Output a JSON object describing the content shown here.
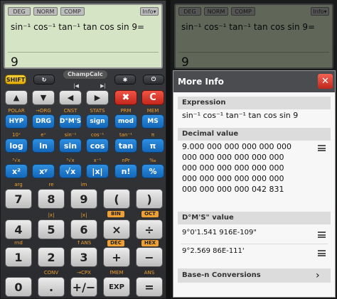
{
  "modes": [
    "DEG",
    "NORM",
    "COMP"
  ],
  "info": "Info",
  "expression": "sin⁻¹ cos⁻¹ tan⁻¹ tan cos sin 9=",
  "result": "9",
  "brand": "ChampCalc",
  "row0": [
    "SHIFT",
    "↻",
    "✱",
    "⏻"
  ],
  "row1": [
    "▲",
    "▼",
    "◀",
    "▶",
    "✖",
    "C"
  ],
  "row1top": [
    "|◀",
    "▶|"
  ],
  "row2lbl": [
    "POLAR",
    "→DRG",
    "CNST",
    "STATS",
    "PRM",
    "MEM"
  ],
  "row2": [
    "HYP",
    "DRG",
    "D°M'S",
    "sign",
    "mod",
    "MS"
  ],
  "row3lbl": [
    "10ˣ",
    "eˣ",
    "sin⁻¹",
    "cos⁻¹",
    "tan⁻¹",
    "π"
  ],
  "row3": [
    "log",
    "ln",
    "sin",
    "cos",
    "tan",
    "π"
  ],
  "row4lbl": [
    "³√x",
    "",
    "³√x",
    "x⁻¹",
    "nPr",
    "‰"
  ],
  "row4": [
    "x²",
    "xʸ",
    "√x",
    "|x|",
    "n!",
    "%"
  ],
  "row5lbl": [
    "arg",
    "re",
    "im",
    "",
    ""
  ],
  "row5": [
    "7",
    "8",
    "9",
    "(",
    ")"
  ],
  "badges": [
    "BIN",
    "OCT",
    "DEC",
    "HEX"
  ],
  "row6lbl": [
    "",
    "|x|",
    "|x|",
    "",
    ""
  ],
  "row6": [
    "4",
    "5",
    "6",
    "×",
    "÷"
  ],
  "row7lbl": [
    "rnd",
    "",
    "↑ANS",
    "",
    ""
  ],
  "row7": [
    "1",
    "2",
    "3",
    "+",
    "−"
  ],
  "row8lbl": [
    "",
    "CONV",
    "→CPX",
    "fMEM",
    "ANS"
  ],
  "row8": [
    "0",
    ".",
    "+/−",
    "EXP",
    "="
  ],
  "dialog": {
    "title": "More Info",
    "close": "✕",
    "expression_header": "Expression",
    "expression": "sin⁻¹ cos⁻¹ tan⁻¹ tan cos sin 9",
    "decimal_header": "Decimal value",
    "decimal_lines": [
      "9.000 000 000 000 000 000",
      "000 000 000 000 000 000",
      "000 000 000 000 000 000",
      "000 000 000 000 000 000",
      "000 000 000 000 042 831"
    ],
    "dms_header": "D°M'S\" value",
    "dms1": "9°0'1.541 916E-109\"",
    "dms2": "9°2.569 86E-111'",
    "basen": "Base-n Conversions",
    "chev": "›"
  }
}
